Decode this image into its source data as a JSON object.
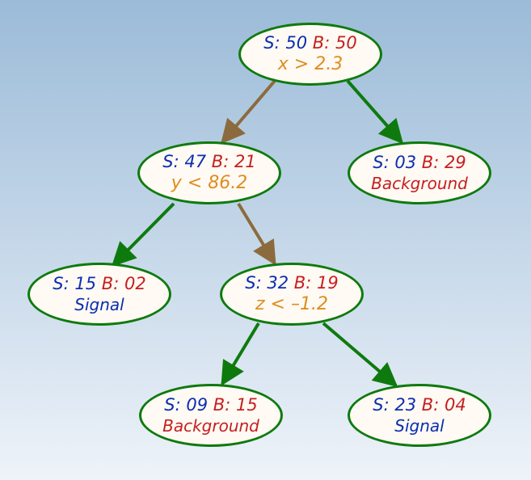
{
  "nodes": {
    "root": {
      "s_label": "S: ",
      "s_val": "50",
      "b_label": " B: ",
      "b_val": "50",
      "cond": "x > 2.3"
    },
    "left": {
      "s_label": "S: ",
      "s_val": "47",
      "b_label": " B: ",
      "b_val": "21",
      "cond": "y < 86.2"
    },
    "right_leaf": {
      "s_label": "S: ",
      "s_val": "03",
      "b_label": " B: ",
      "b_val": "29",
      "class": "Background",
      "class_type": "bg"
    },
    "ll_leaf": {
      "s_label": "S: ",
      "s_val": "15",
      "b_label": " B: ",
      "b_val": "02",
      "class": "Signal",
      "class_type": "sig"
    },
    "lr": {
      "s_label": "S: ",
      "s_val": "32",
      "b_label": " B: ",
      "b_val": "19",
      "cond": "z < –1.2"
    },
    "lrl_leaf": {
      "s_label": "S: ",
      "s_val": "09",
      "b_label": " B: ",
      "b_val": "15",
      "class": "Background",
      "class_type": "bg"
    },
    "lrr_leaf": {
      "s_label": "S: ",
      "s_val": "23",
      "b_label": " B: ",
      "b_val": "04",
      "class": "Signal",
      "class_type": "sig"
    }
  },
  "chart_data": {
    "type": "diagram",
    "description": "Decision tree with signal/background counts at each node",
    "tree": {
      "S": 50,
      "B": 50,
      "split": "x > 2.3",
      "true": {
        "S": 47,
        "B": 21,
        "split": "y < 86.2",
        "true": {
          "S": 15,
          "B": 2,
          "class": "Signal"
        },
        "false": {
          "S": 32,
          "B": 19,
          "split": "z < -1.2",
          "true": {
            "S": 9,
            "B": 15,
            "class": "Background"
          },
          "false": {
            "S": 23,
            "B": 4,
            "class": "Signal"
          }
        }
      },
      "false": {
        "S": 3,
        "B": 29,
        "class": "Background"
      }
    }
  }
}
